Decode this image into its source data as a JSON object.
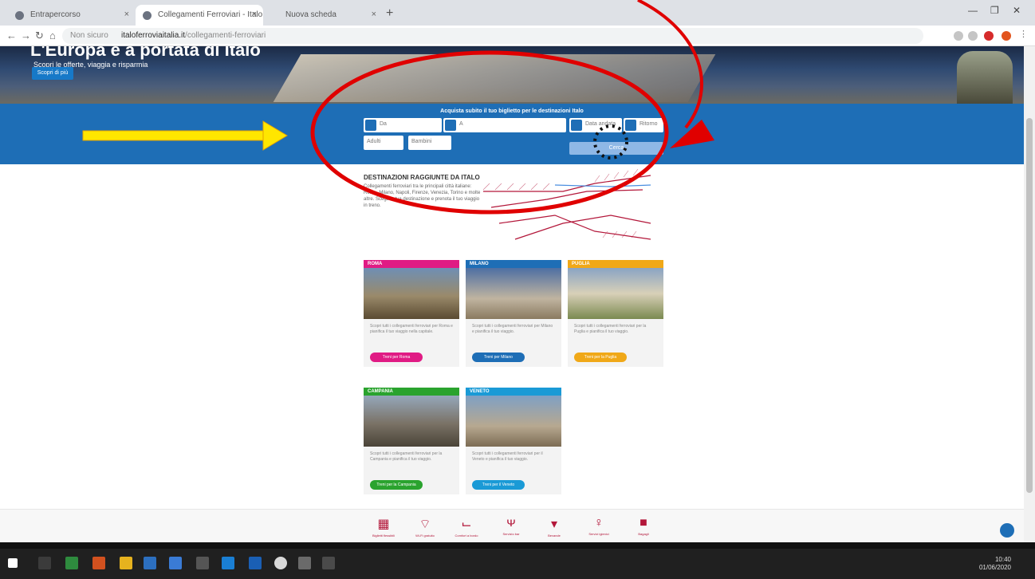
{
  "browser": {
    "tabs": [
      {
        "title": "Entrapercorso",
        "active": false
      },
      {
        "title": "Collegamenti Ferroviari - Italo",
        "active": true
      },
      {
        "title": "Nuova scheda",
        "active": false
      }
    ],
    "address": {
      "site_info": "Non sicuro",
      "host": "italoferroviaitalia.it",
      "path": "/collegamenti-ferroviari"
    },
    "new_tab_label": "+"
  },
  "hero": {
    "title": "L'Europa è a portata di Italo",
    "subtitle": "Scopri le offerte, viaggia e risparmia",
    "cta_label": "Scopri di più"
  },
  "search": {
    "title": "Acquista subito il tuo biglietto per le destinazioni Italo",
    "from_value": "Da",
    "to_value": "A",
    "date_value": "Data andata",
    "return_value": "Ritorno",
    "adults_label": "Adulti",
    "children_label": "Bambini",
    "search_label": "Cerca"
  },
  "intro": {
    "title": "DESTINAZIONI RAGGIUNTE DA ITALO",
    "text": "Collegamenti ferroviari tra le principali città italiane: Roma, Milano, Napoli, Firenze, Venezia, Torino e molte altre. Scegli la tua destinazione e prenota il tuo viaggio in treno."
  },
  "cards": [
    {
      "city": "ROMA",
      "color": "#e01b84",
      "text": "Scopri tutti i collegamenti ferroviari per Roma e pianifica il tuo viaggio nella capitale.",
      "button": "Treni per Roma"
    },
    {
      "city": "MILANO",
      "color": "#1e6eb6",
      "text": "Scopri tutti i collegamenti ferroviari per Milano e pianifica il tuo viaggio.",
      "button": "Treni per Milano"
    },
    {
      "city": "PUGLIA",
      "color": "#f0a818",
      "text": "Scopri tutti i collegamenti ferroviari per la Puglia e pianifica il tuo viaggio.",
      "button": "Treni per la Puglia"
    },
    {
      "city": "CAMPANIA",
      "color": "#2aa32e",
      "text": "Scopri tutti i collegamenti ferroviari per la Campania e pianifica il tuo viaggio.",
      "button": "Treni per la Campania"
    },
    {
      "city": "VENETO",
      "color": "#1a9ad6",
      "text": "Scopri tutti i collegamenti ferroviari per il Veneto e pianifica il tuo viaggio.",
      "button": "Treni per il Veneto"
    }
  ],
  "features": [
    {
      "icon": "calendar-icon",
      "glyph": "▦",
      "label": "Biglietti flessibili"
    },
    {
      "icon": "wifi-icon",
      "glyph": "⌔",
      "label": "Wi-Fi gratuito"
    },
    {
      "icon": "seat-icon",
      "glyph": "⌙",
      "label": "Comfort a bordo"
    },
    {
      "icon": "food-icon",
      "glyph": "ᴪ",
      "label": "Servizio bar"
    },
    {
      "icon": "drink-icon",
      "glyph": "▾",
      "label": "Bevande"
    },
    {
      "icon": "toilet-icon",
      "glyph": "♀",
      "label": "Servizi igienici"
    },
    {
      "icon": "luggage-icon",
      "glyph": "■",
      "label": "Bagagli"
    }
  ],
  "taskbar": {
    "time": "10:40",
    "date": "01/06/2020"
  },
  "colors": {
    "brand_blue": "#1e6eb6",
    "brand_red": "#b3173a",
    "annotation_red": "#e00000",
    "annotation_yellow": "#ffe600"
  }
}
